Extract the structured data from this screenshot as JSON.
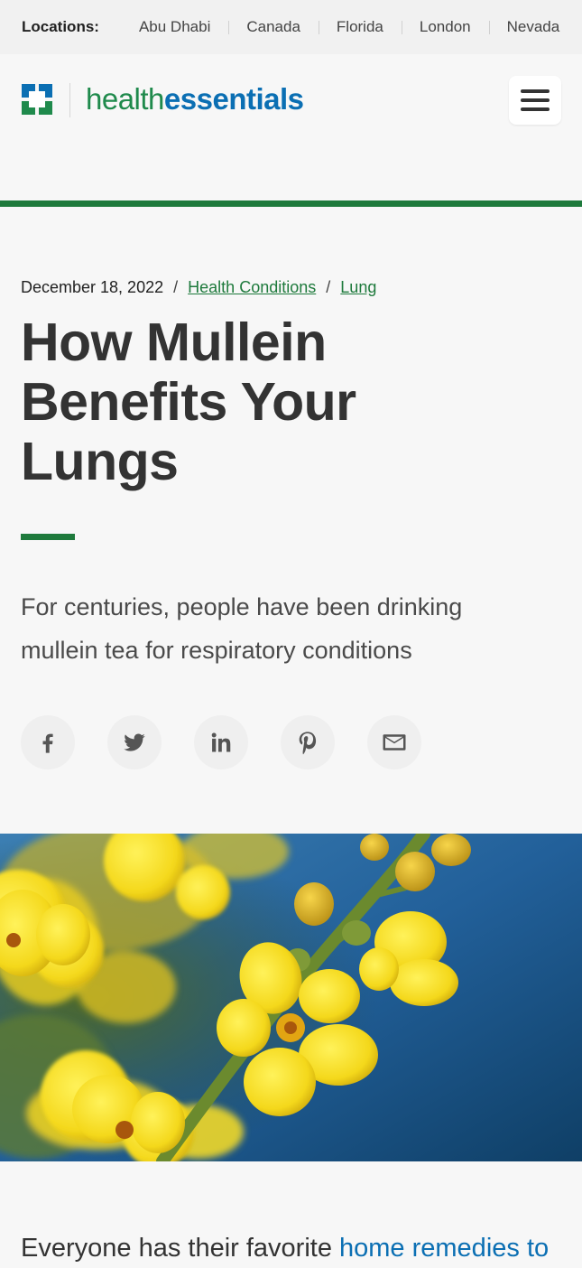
{
  "locations": {
    "label": "Locations:",
    "items": [
      "Abu Dhabi",
      "Canada",
      "Florida",
      "London",
      "Nevada"
    ]
  },
  "brand": {
    "name_part1": "health",
    "name_part2": "essentials",
    "colors": {
      "green": "#1f8a4c",
      "blue": "#0b6fb3"
    }
  },
  "header": {
    "menu_icon": "hamburger-icon"
  },
  "article": {
    "date": "December 18, 2022",
    "separator": "/",
    "categories": [
      "Health Conditions",
      "Lung"
    ],
    "title": "How Mullein Benefits Your Lungs",
    "subtitle": "For centuries, people have been drinking mullein tea for respiratory conditions",
    "share_icons": [
      "facebook-icon",
      "twitter-icon",
      "linkedin-icon",
      "pinterest-icon",
      "email-icon"
    ],
    "body_intro": "Everyone has their favorite ",
    "body_link": "home remedies to"
  },
  "accent_color": "#1e7a3c"
}
